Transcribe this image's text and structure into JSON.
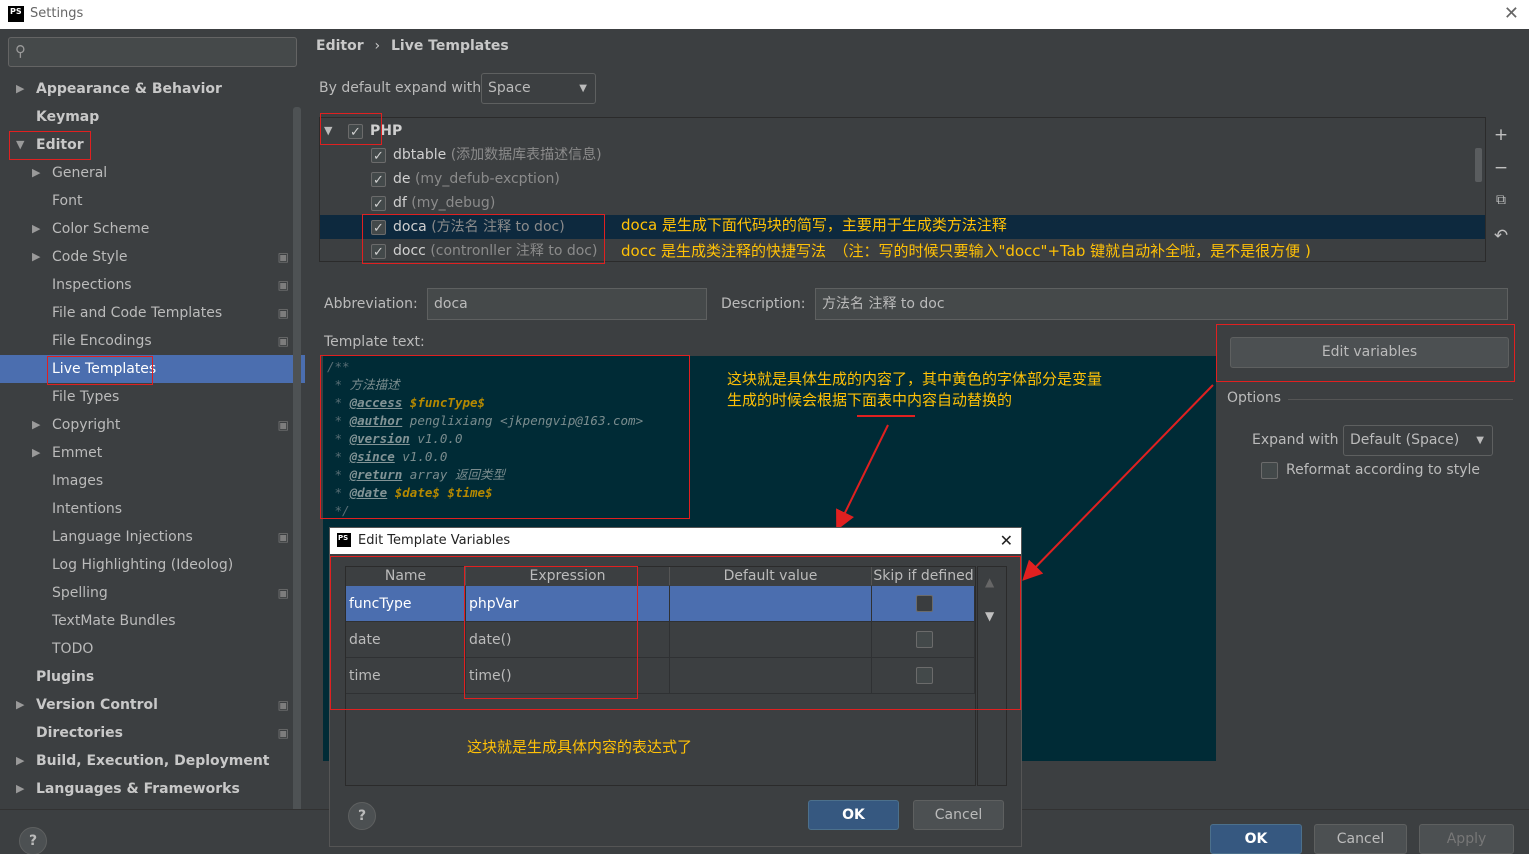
{
  "window": {
    "title": "Settings",
    "logo": "PS"
  },
  "sidebar": {
    "search_placeholder": "",
    "items": [
      {
        "label": "Appearance & Behavior",
        "arrow": "▶"
      },
      {
        "label": "Keymap"
      },
      {
        "label": "Editor",
        "arrow": "▼"
      },
      {
        "label": "General",
        "arrow": "▶"
      },
      {
        "label": "Font"
      },
      {
        "label": "Color Scheme",
        "arrow": "▶"
      },
      {
        "label": "Code Style",
        "arrow": "▶"
      },
      {
        "label": "Inspections"
      },
      {
        "label": "File and Code Templates"
      },
      {
        "label": "File Encodings"
      },
      {
        "label": "Live Templates"
      },
      {
        "label": "File Types"
      },
      {
        "label": "Copyright",
        "arrow": "▶"
      },
      {
        "label": "Emmet",
        "arrow": "▶"
      },
      {
        "label": "Images"
      },
      {
        "label": "Intentions"
      },
      {
        "label": "Language Injections"
      },
      {
        "label": "Log Highlighting (Ideolog)"
      },
      {
        "label": "Spelling"
      },
      {
        "label": "TextMate Bundles"
      },
      {
        "label": "TODO"
      },
      {
        "label": "Plugins"
      },
      {
        "label": "Version Control",
        "arrow": "▶"
      },
      {
        "label": "Directories"
      },
      {
        "label": "Build, Execution, Deployment",
        "arrow": "▶"
      },
      {
        "label": "Languages & Frameworks",
        "arrow": "▶"
      }
    ]
  },
  "breadcrumb": {
    "part1": "Editor",
    "sep": "›",
    "part2": "Live Templates"
  },
  "expand": {
    "label": "By default expand with",
    "value": "Space"
  },
  "templates": {
    "group": "PHP",
    "items": [
      {
        "abbr": "dbtable",
        "desc": "(添加数据库表描述信息)"
      },
      {
        "abbr": "de",
        "desc": "(my_defub-excption)"
      },
      {
        "abbr": "df",
        "desc": "(my_debug)"
      },
      {
        "abbr": "doca",
        "desc": "(方法名 注释 to doc)"
      },
      {
        "abbr": "docc",
        "desc": "(contronller 注释 to doc)"
      }
    ]
  },
  "annotations": {
    "doca": "doca 是生成下面代码块的简写，主要用于生成类方法注释",
    "docc": "docc 是生成类注释的快捷写法　（注：写的时候只要输入\"docc\"+Tab 键就自动补全啦，是不是很方便 )",
    "template_line1": "这块就是具体生成的内容了，其中黄色的字体部分是变量",
    "template_line2": "生成的时候会根据下面表中内容自动替换的",
    "expression": "这块就是生成具体内容的表达式了"
  },
  "abbreviation": {
    "label": "Abbreviation:",
    "value": "doca"
  },
  "description": {
    "label": "Description:",
    "value": "方法名 注释 to doc"
  },
  "template_text": {
    "label": "Template text:",
    "line0": "/**",
    "line1_prefix": " * ",
    "line1_text": "方法描述",
    "l2_tag": "@access",
    "l2_var": "$funcType$",
    "l3_tag": "@author",
    "l3_text": "penglixiang <jkpengvip@163.com>",
    "l4_tag": "@version",
    "l4_text": "v1.0.0",
    "l5_tag": "@since",
    "l5_text": "v1.0.0",
    "l6_tag": "@return",
    "l6_text": "array 返回类型",
    "l7_tag": "@date",
    "l7_var": "$date$ $time$",
    "line8": " */"
  },
  "edit_variables_button": "Edit variables",
  "options": {
    "title": "Options",
    "expand_label": "Expand with",
    "expand_value": "Default (Space)",
    "reformat_label": "Reformat according to style"
  },
  "buttons": {
    "ok": "OK",
    "cancel": "Cancel",
    "apply": "Apply",
    "help": "?"
  },
  "dialog": {
    "title": "Edit Template Variables",
    "columns": [
      "Name",
      "Expression",
      "Default value",
      "Skip if defined"
    ],
    "rows": [
      {
        "name": "funcType",
        "expression": "phpVar",
        "default": ""
      },
      {
        "name": "date",
        "expression": "date()",
        "default": ""
      },
      {
        "name": "time",
        "expression": "time()",
        "default": ""
      }
    ],
    "ok": "OK",
    "cancel": "Cancel",
    "help": "?"
  },
  "colors": {
    "selection": "#4b6eaf",
    "editor_bg": "#002b36",
    "annotation": "#ffc107",
    "highlight_box": "#e02020"
  }
}
